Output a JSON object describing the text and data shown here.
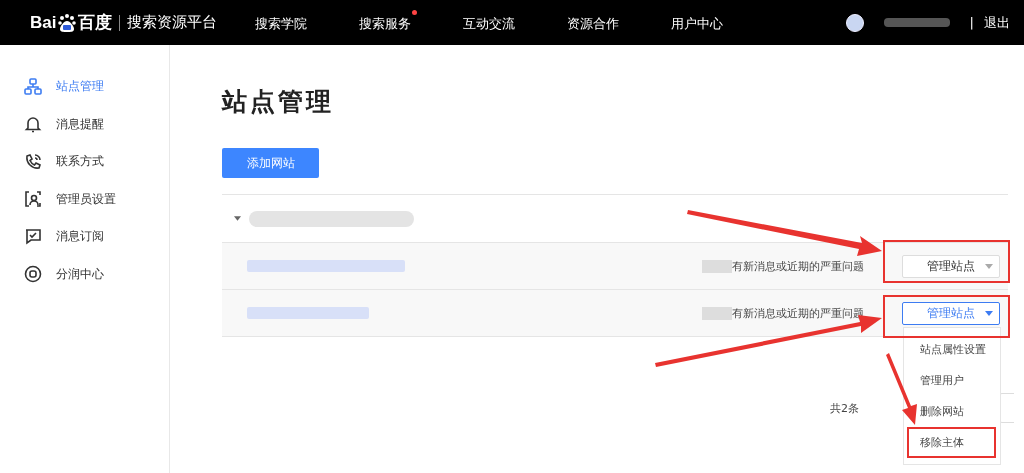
{
  "header": {
    "logo": {
      "text_left": "Bai",
      "text_right": "百度"
    },
    "platform_name": "搜索资源平台",
    "nav": [
      {
        "label": "搜索学院",
        "dot": false
      },
      {
        "label": "搜索服务",
        "dot": true
      },
      {
        "label": "互动交流",
        "dot": false
      },
      {
        "label": "资源合作",
        "dot": false
      },
      {
        "label": "用户中心",
        "dot": false
      }
    ],
    "user": {
      "separator": "|",
      "logout": "退出"
    }
  },
  "sidebar": {
    "items": [
      {
        "label": "站点管理",
        "kind": "sitemap",
        "selected": true
      },
      {
        "label": "消息提醒",
        "kind": "bell",
        "selected": false
      },
      {
        "label": "联系方式",
        "kind": "phone",
        "selected": false
      },
      {
        "label": "管理员设置",
        "kind": "admin",
        "selected": false
      },
      {
        "label": "消息订阅",
        "kind": "subscribe",
        "selected": false
      },
      {
        "label": "分润中心",
        "kind": "share",
        "selected": false
      }
    ]
  },
  "page_title": "站点管理",
  "add_button": "添加网站",
  "site_group": {
    "expanded": true,
    "rows": [
      {
        "status": "有新消息或近期的严重问题",
        "manage_button": "管理站点",
        "menu_open": false
      },
      {
        "status": "有新消息或近期的严重问题",
        "manage_button": "管理站点",
        "menu_open": true
      }
    ]
  },
  "dropdown_menu": {
    "items": [
      {
        "label": "站点属性设置",
        "highlighted": false
      },
      {
        "label": "管理用户",
        "highlighted": false
      },
      {
        "label": "删除网站",
        "highlighted": false
      },
      {
        "label": "移除主体",
        "highlighted": true
      }
    ]
  },
  "pagination": {
    "total": "共2条"
  }
}
